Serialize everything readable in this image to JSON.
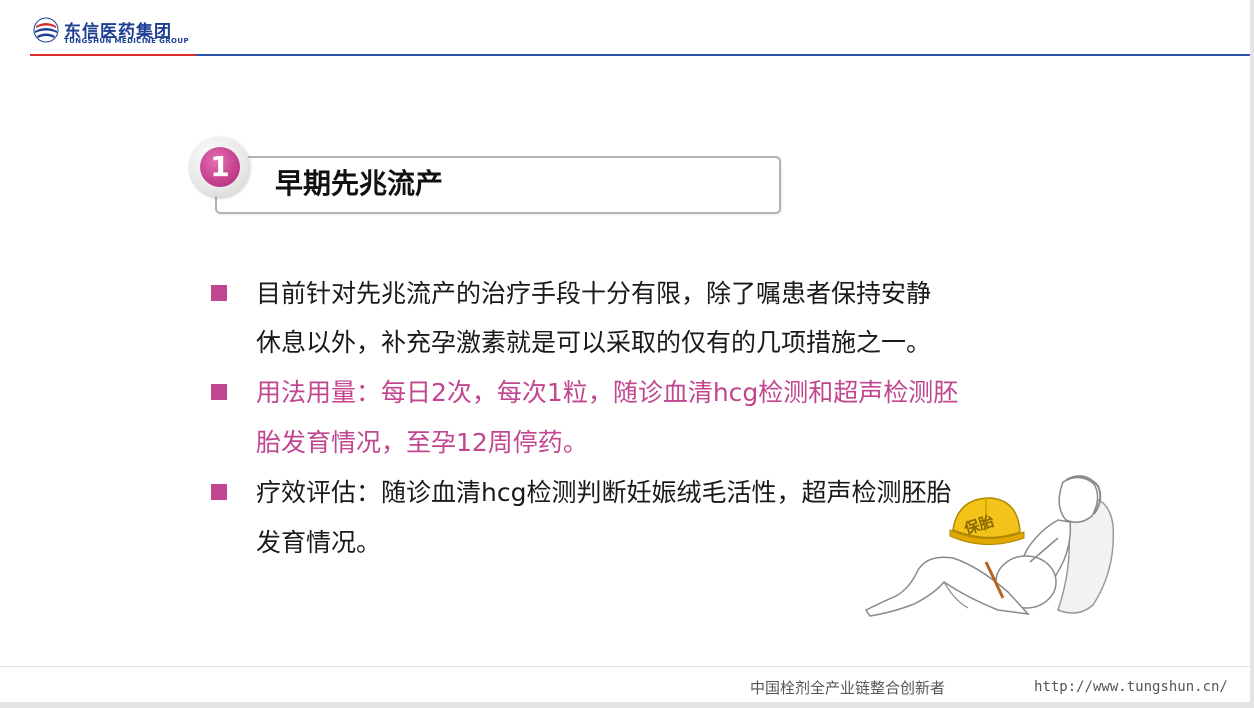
{
  "header": {
    "logo_cn": "东信医药集团",
    "logo_en": "TUNGSHUN MEDICINE GROUP",
    "logo_icon": "tungshun-logo-icon",
    "colors": {
      "brand_blue": "#1d3f93",
      "accent_red": "#d92b2b",
      "line_blue": "#2e55a8"
    }
  },
  "section": {
    "number": "1",
    "title": "早期先兆流产",
    "badge_color": "#c13d8b"
  },
  "bullets": [
    {
      "lines": [
        "目前针对先兆流产的治疗手段十分有限，除了嘱患者保持安静",
        "休息以外，补充孕激素就是可以采取的仅有的几项措施之一。"
      ],
      "color": "#1a1a1a"
    },
    {
      "lines": [
        "用法用量：每日2次，每次1粒，随诊血清hcg检测和超声检测胚",
        "胎发育情况，至孕12周停药。"
      ],
      "color": "#c2468f"
    },
    {
      "lines": [
        "疗效评估：随诊血清hcg检测判断妊娠绒毛活性，超声检测胚胎",
        "发育情况。"
      ],
      "color": "#1a1a1a"
    }
  ],
  "illustration": {
    "icon": "pregnant-woman-with-helmet-illustration",
    "helmet_label": "保胎"
  },
  "footer": {
    "slogan": "中国栓剂全产业链整合创新者",
    "url": "http://www.tungshun.cn/"
  }
}
